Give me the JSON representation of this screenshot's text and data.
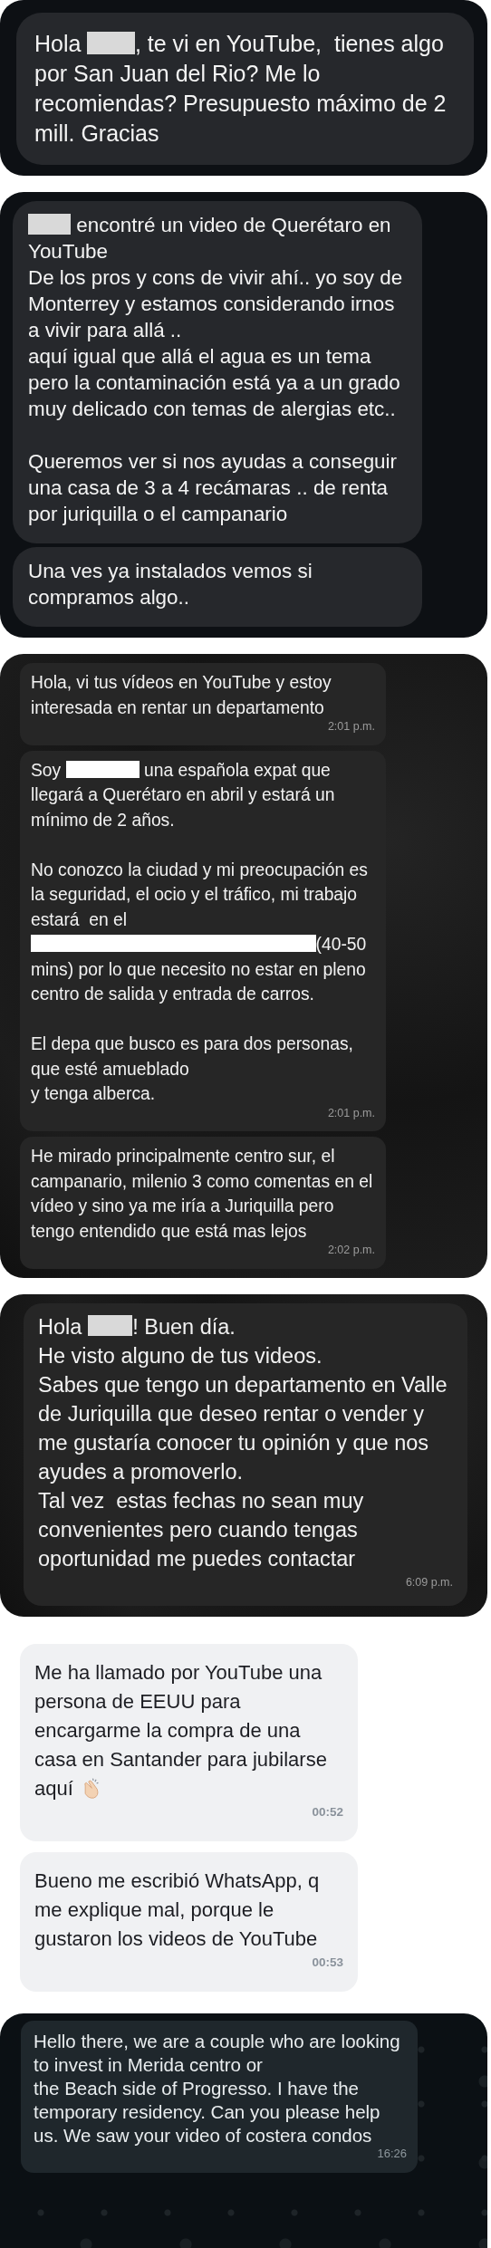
{
  "panels": [
    {
      "kind": "dark",
      "messages": [
        {
          "parts": [
            {
              "kind": "text",
              "text": "Hola "
            },
            {
              "kind": "redaction"
            },
            {
              "kind": "text",
              "text": ", te vi en YouTube,  tienes algo por San Juan del Rio? Me lo recomiendas? Presupuesto máximo de 2 mill. Gracias"
            }
          ]
        }
      ]
    },
    {
      "kind": "dark-compact",
      "messages": [
        {
          "parts": [
            {
              "kind": "redaction"
            },
            {
              "kind": "text",
              "text": " encontré un video de Querétaro en YouTube\nDe los pros y cons de vivir ahí.. yo soy de Monterrey y estamos considerando irnos a vivir para allá ..\naquí igual que allá el agua es un tema pero la contaminación está ya a un grado muy delicado con temas de alergias etc..\n\nQueremos ver si nos ayudas a conseguir una casa de 3 a 4 recámaras .. de renta por juriquilla o el campanario"
            }
          ]
        },
        {
          "parts": [
            {
              "kind": "text",
              "text": "Una ves ya instalados vemos si compramos algo.."
            }
          ]
        }
      ]
    },
    {
      "kind": "textured",
      "messages": [
        {
          "parts": [
            {
              "kind": "text",
              "text": "Hola, vi tus vídeos en YouTube y estoy interesada en rentar un departamento"
            }
          ],
          "time": "2:01 p.m."
        },
        {
          "parts": [
            {
              "kind": "text",
              "text": "Soy "
            },
            {
              "kind": "redaction"
            },
            {
              "kind": "text",
              "text": " una española expat que llegará a Querétaro en abril y estará un mínimo de 2 años.\n\nNo conozco la ciudad y mi preocupación es la seguridad, el ocio y el tráfico, mi trabajo estará  en el "
            },
            {
              "kind": "redaction-wide"
            },
            {
              "kind": "text",
              "text": "(40-50 mins) por lo que necesito no estar en pleno centro de salida y entrada de carros.\n\nEl depa que busco es para dos personas, que esté amueblado\ny tenga alberca."
            }
          ],
          "time": "2:01 p.m."
        },
        {
          "parts": [
            {
              "kind": "text",
              "text": "He mirado principalmente centro sur, el campanario, milenio 3 como comentas en el vídeo y sino ya me iría a Juriquilla pero tengo entendido que está mas lejos"
            }
          ],
          "time": "2:02 p.m."
        }
      ]
    },
    {
      "kind": "textured-large",
      "messages": [
        {
          "parts": [
            {
              "kind": "text",
              "text": "Hola "
            },
            {
              "kind": "redaction"
            },
            {
              "kind": "text",
              "text": "! Buen día.\nHe visto alguno de tus videos.\nSabes que tengo un departamento en Valle de Juriquilla que deseo rentar o vender y me gustaría conocer tu opinión y que nos ayudes a promoverlo.\nTal vez  estas fechas no sean muy convenientes pero cuando tengas oportunidad me puedes contactar"
            }
          ],
          "time": "6:09 p.m."
        }
      ]
    },
    {
      "kind": "light",
      "messages": [
        {
          "parts": [
            {
              "kind": "text",
              "text": "Me ha llamado por YouTube una persona de EEUU para encargarme la compra de una casa en Santander para jubilarse aquí"
            },
            {
              "kind": "icon"
            }
          ],
          "time": "00:52"
        },
        {
          "parts": [
            {
              "kind": "text",
              "text": "Bueno me escribió WhatsApp, q me explique mal, porque le gustaron los videos de YouTube"
            }
          ],
          "time": "00:53"
        }
      ]
    },
    {
      "kind": "whatsapp",
      "messages": [
        {
          "parts": [
            {
              "kind": "text",
              "text": "Hello there, we are a couple who are looking to invest in Merida centro or\nthe Beach side of Progresso. I have the temporary residency. Can you please help us. We saw your video of costera condos"
            }
          ],
          "time": "16:26"
        }
      ]
    }
  ]
}
